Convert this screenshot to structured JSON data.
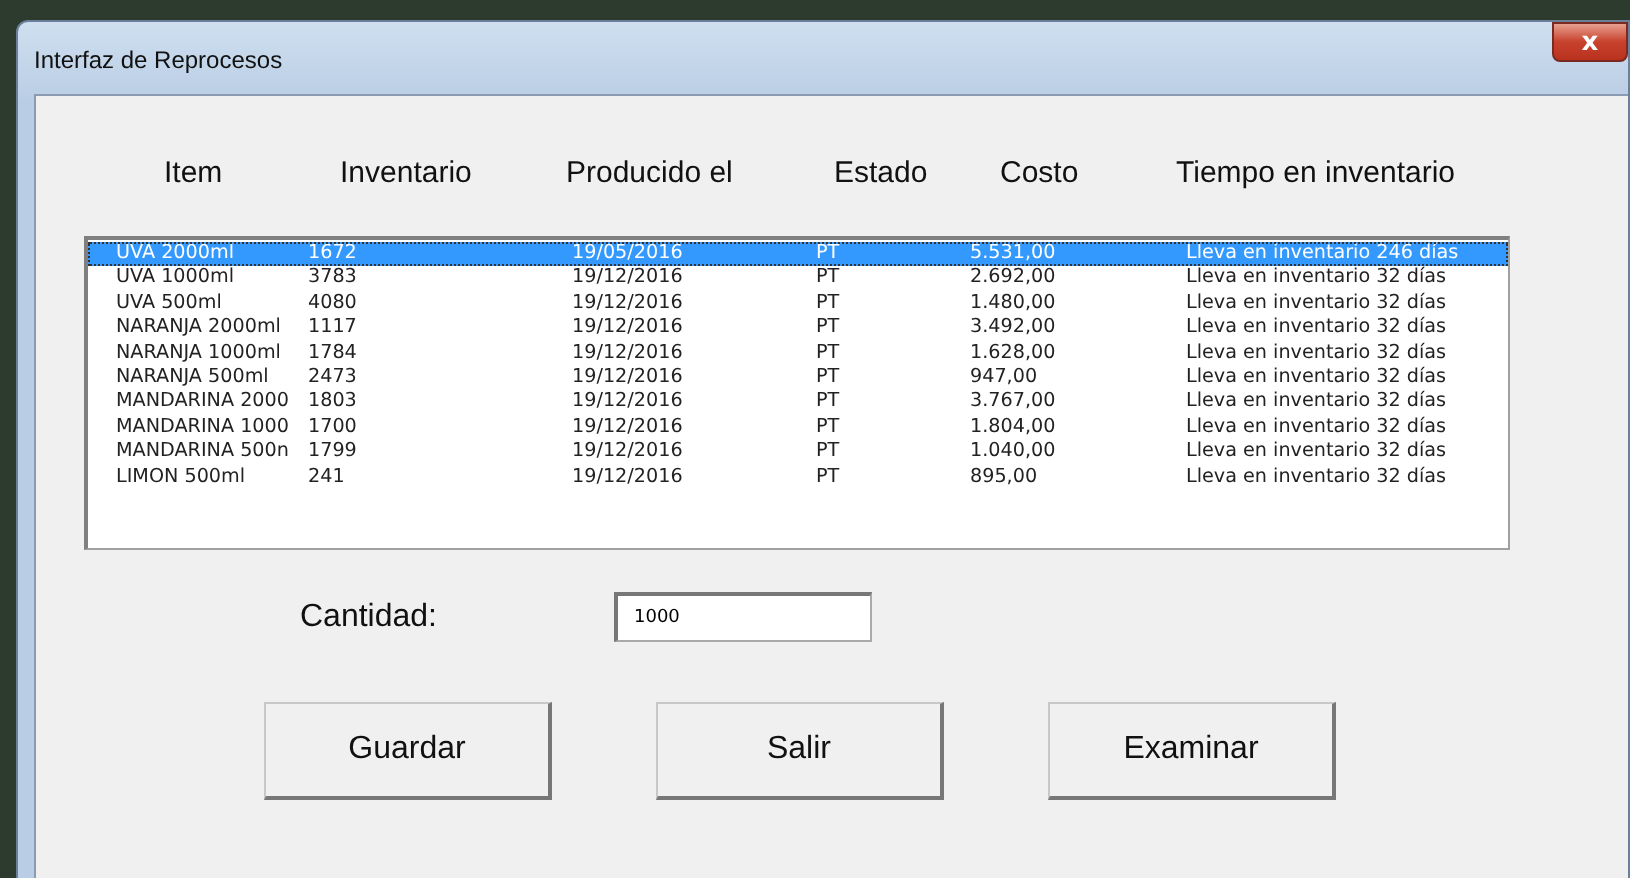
{
  "window": {
    "title": "Interfaz de Reprocesos",
    "close": "x"
  },
  "table": {
    "columns": [
      "Item",
      "Inventario",
      "Producido el",
      "Estado",
      "Costo",
      "Tiempo en inventario"
    ],
    "rows": [
      {
        "cells": [
          "UVA 2000ml",
          "1672",
          "19/05/2016",
          "PT",
          "5.531,00",
          "Lleva en inventario 246 días"
        ],
        "selected": true
      },
      {
        "cells": [
          "UVA 1000ml",
          "3783",
          "19/12/2016",
          "PT",
          "2.692,00",
          "Lleva en inventario 32 días"
        ],
        "selected": false
      },
      {
        "cells": [
          "UVA 500ml",
          "4080",
          "19/12/2016",
          "PT",
          "1.480,00",
          "Lleva en inventario 32 días"
        ],
        "selected": false
      },
      {
        "cells": [
          "NARANJA 2000ml",
          "1117",
          "19/12/2016",
          "PT",
          "3.492,00",
          "Lleva en inventario 32 días"
        ],
        "selected": false
      },
      {
        "cells": [
          "NARANJA 1000ml",
          "1784",
          "19/12/2016",
          "PT",
          "1.628,00",
          "Lleva en inventario 32 días"
        ],
        "selected": false
      },
      {
        "cells": [
          "NARANJA 500ml",
          "2473",
          "19/12/2016",
          "PT",
          "947,00",
          "Lleva en inventario 32 días"
        ],
        "selected": false
      },
      {
        "cells": [
          "MANDARINA 2000",
          "1803",
          "19/12/2016",
          "PT",
          "3.767,00",
          "Lleva en inventario 32 días"
        ],
        "selected": false
      },
      {
        "cells": [
          "MANDARINA 1000",
          "1700",
          "19/12/2016",
          "PT",
          "1.804,00",
          "Lleva en inventario 32 días"
        ],
        "selected": false
      },
      {
        "cells": [
          "MANDARINA 500n",
          "1799",
          "19/12/2016",
          "PT",
          "1.040,00",
          "Lleva en inventario 32 días"
        ],
        "selected": false
      },
      {
        "cells": [
          "LIMON 500ml",
          "241",
          "19/12/2016",
          "PT",
          "895,00",
          "Lleva en inventario 32 días"
        ],
        "selected": false
      }
    ]
  },
  "quantity": {
    "label": "Cantidad:",
    "value": "1000"
  },
  "buttons": [
    "Guardar",
    "Salir",
    "Examinar"
  ]
}
